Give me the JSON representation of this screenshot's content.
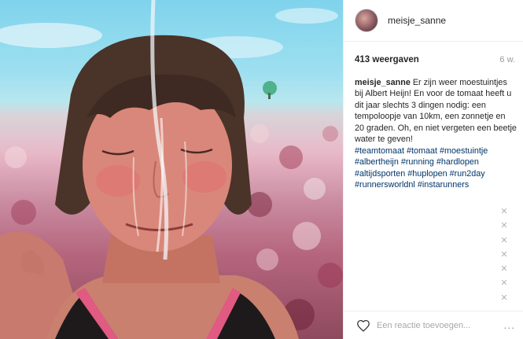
{
  "post": {
    "username": "meisje_sanne",
    "views": "413 weergaven",
    "age": "6 w."
  },
  "caption": {
    "username": "meisje_sanne",
    "text": "Er zijn weer moestuintjes bij Albert Heijn! En voor de tomaat heeft u dit jaar slechts 3 dingen nodig: een tempoloopje van 10km, een zonnetje en 20 graden. Oh, en niet vergeten een beetje water te geven!"
  },
  "hashtags": [
    "#teamtomaat",
    "#tomaat",
    "#moestuintje",
    "#albertheijn",
    "#running",
    "#hardlopen",
    "#altijdsporten",
    "#huplopen",
    "#run2day",
    "#runnersworldnl",
    "#instarunners"
  ],
  "close_icons": [
    "close-icon",
    "close-icon",
    "close-icon",
    "close-icon",
    "close-icon",
    "close-icon",
    "close-icon"
  ],
  "comment": {
    "placeholder": "Een reactie toevoegen...",
    "more": "..."
  }
}
